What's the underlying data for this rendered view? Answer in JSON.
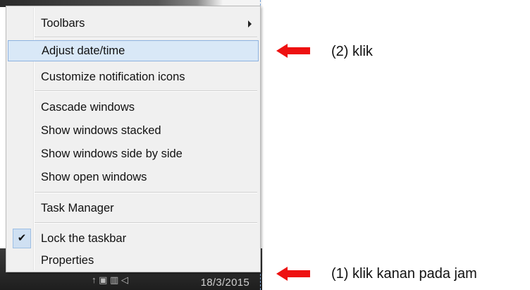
{
  "menu": {
    "items": [
      {
        "label": "Toolbars",
        "has_submenu": true
      },
      {
        "label": "Adjust date/time",
        "highlighted": true
      },
      {
        "label": "Customize notification icons"
      },
      {
        "label": "Cascade windows"
      },
      {
        "label": "Show windows stacked"
      },
      {
        "label": "Show windows side by side"
      },
      {
        "label": "Show open windows"
      },
      {
        "label": "Task Manager"
      },
      {
        "label": "Lock the taskbar",
        "checked": true
      },
      {
        "label": "Properties"
      }
    ],
    "check_glyph": "✔"
  },
  "taskbar": {
    "clock_date": "18/3/2015",
    "tray_glyphs": "↑  ▣  ▥  ◁"
  },
  "annotations": {
    "step2": "(2) klik",
    "step1": "(1) klik kanan pada jam"
  },
  "colors": {
    "arrow": "#ee1111",
    "highlight_bg": "#d9e8f7",
    "highlight_border": "#8db2e0"
  }
}
